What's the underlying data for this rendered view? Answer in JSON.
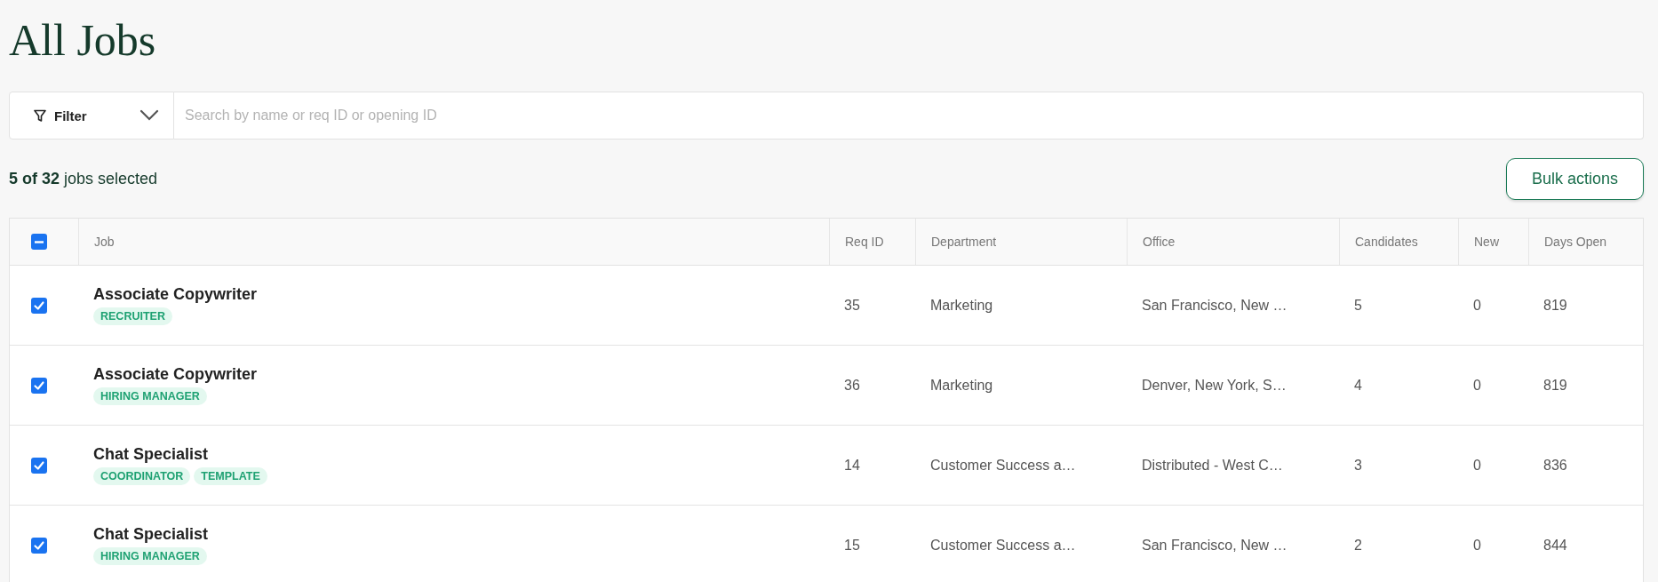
{
  "page": {
    "title": "All Jobs"
  },
  "filter": {
    "label": "Filter",
    "search_placeholder": "Search by name or req ID or opening ID"
  },
  "selection": {
    "summary": "**5 of 32** jobs selected",
    "bulk_button": "Bulk actions"
  },
  "table": {
    "select_all": {
      "indeterminate": true
    },
    "columns": [
      "Job",
      "Req ID",
      "Department",
      "Office",
      "Candidates",
      "New",
      "Days Open"
    ],
    "rows": [
      {
        "selected": true,
        "job": "Associate Copywriter",
        "tags": [
          "RECRUITER"
        ],
        "req_id": "35",
        "department": "Marketing",
        "office": "San Francisco, New …",
        "candidates": "5",
        "new": "0",
        "days_open": "819"
      },
      {
        "selected": true,
        "job": "Associate Copywriter",
        "tags": [
          "HIRING MANAGER"
        ],
        "req_id": "36",
        "department": "Marketing",
        "office": "Denver, New York, S…",
        "candidates": "4",
        "new": "0",
        "days_open": "819"
      },
      {
        "selected": true,
        "job": "Chat Specialist",
        "tags": [
          "COORDINATOR",
          "TEMPLATE"
        ],
        "req_id": "14",
        "department": "Customer Success a…",
        "office": "Distributed - West C…",
        "candidates": "3",
        "new": "0",
        "days_open": "836"
      },
      {
        "selected": true,
        "job": "Chat Specialist",
        "tags": [
          "HIRING MANAGER"
        ],
        "req_id": "15",
        "department": "Customer Success a…",
        "office": "San Francisco, New …",
        "candidates": "2",
        "new": "0",
        "days_open": "844"
      }
    ]
  }
}
